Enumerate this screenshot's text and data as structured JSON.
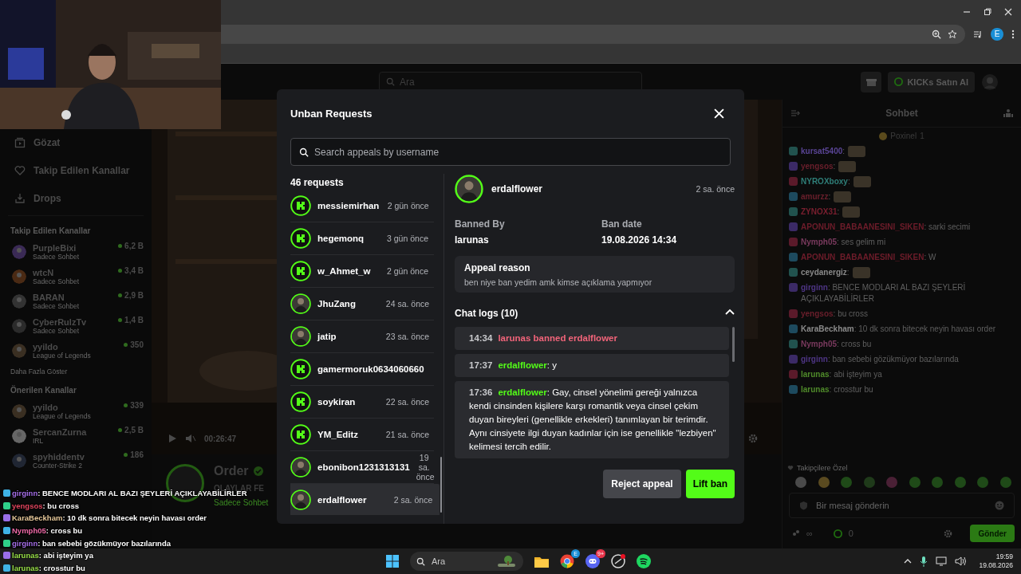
{
  "browser": {
    "profile_initial": "E"
  },
  "site": {
    "search": {
      "placeholder": "Ara"
    },
    "kicks_button": "KICKs Satın Al"
  },
  "sidebar": {
    "nav": [
      {
        "kind": "browse",
        "label": "Gözat"
      },
      {
        "kind": "following",
        "label": "Takip Edilen Kanallar"
      },
      {
        "kind": "drops",
        "label": "Drops"
      }
    ],
    "followed_title": "Takip Edilen Kanallar",
    "followed": [
      {
        "name": "PurpleBixi",
        "category": "Sadece Sohbet",
        "viewers": "6,2 B"
      },
      {
        "name": "wtcN",
        "category": "Sadece Sohbet",
        "viewers": "3,4 B"
      },
      {
        "name": "BARAN",
        "category": "Sadece Sohbet",
        "viewers": "2,9 B"
      },
      {
        "name": "CyberRulzTv",
        "category": "Sadece Sohbet",
        "viewers": "1,4 B"
      },
      {
        "name": "yyildo",
        "category": "League of Legends",
        "viewers": "350"
      }
    ],
    "show_more": "Daha Fazla Göster",
    "recommended_title": "Önerilen Kanallar",
    "recommended": [
      {
        "name": "yyildo",
        "category": "League of Legends",
        "viewers": "339"
      },
      {
        "name": "SercanZurna",
        "category": "IRL",
        "viewers": "2,5 B"
      },
      {
        "name": "spyhiddentv",
        "category": "Counter-Strike 2",
        "viewers": "186"
      }
    ]
  },
  "player": {
    "time": "00:26:47",
    "channel": {
      "name": "Order",
      "verified": true,
      "title": "OLAYLAR FE",
      "category": "Sadece Sohbet"
    }
  },
  "chat": {
    "title": "Sohbet",
    "pinned": {
      "user": "Poxinel",
      "count": "1"
    },
    "messages": [
      {
        "kind": "emote",
        "user": "kursat5400",
        "color": "#5a4596",
        "text": ":"
      },
      {
        "kind": "emote",
        "user": "yengsos",
        "color": "#6b1f2c",
        "text": ":"
      },
      {
        "kind": "emote",
        "user": "NYROXboxy",
        "color": "#2f7f79",
        "text": ":"
      },
      {
        "kind": "emote",
        "user": "amurzz",
        "color": "#6b1f2c",
        "text": ":"
      },
      {
        "kind": "emote",
        "user": "ZYNOX31",
        "color": "#7a1f2f",
        "text": ":"
      },
      {
        "kind": "text",
        "user": "APONUN_BABAANESINI_SIKEN",
        "color": "#6e1c2a",
        "text": ": sarki secimi"
      },
      {
        "kind": "text",
        "user": "Nymph05",
        "color": "#7a3a5e",
        "text": ": ses gelim mi"
      },
      {
        "kind": "text",
        "user": "APONUN_BABAANESINI_SIKEN",
        "color": "#6e1c2a",
        "text": ": W"
      },
      {
        "kind": "emote",
        "user": "ceydanergiz",
        "color": "#8a8a8a",
        "text": ":"
      },
      {
        "kind": "text",
        "user": "girginn",
        "color": "#4e3585",
        "text": ": BENCE MODLARI AL BAZI ŞEYLERİ AÇIKLAYABİLİRLER"
      },
      {
        "kind": "text",
        "user": "yengsos",
        "color": "#6b1f2c",
        "text": ": bu cross"
      },
      {
        "kind": "text",
        "user": "KaraBeckham",
        "color": "#8a8a8a",
        "text": ": 10 dk sonra bitecek neyin havası order"
      },
      {
        "kind": "text",
        "user": "Nymph05",
        "color": "#7a3a5e",
        "text": ": cross bu"
      },
      {
        "kind": "text",
        "user": "girginn",
        "color": "#4e3585",
        "text": ": ban sebebi gözükmüyor bazılarında"
      },
      {
        "kind": "text",
        "user": "larunas",
        "color": "#4f8a2a",
        "text": ": abi işteyim ya"
      },
      {
        "kind": "text",
        "user": "larunas",
        "color": "#4f8a2a",
        "text": ": crosstur bu"
      }
    ],
    "followers_only": "Takipçilere Özel",
    "input": {
      "placeholder": "Bir mesaj gönderin"
    },
    "footer": {
      "infinity": "∞",
      "kicks": "0",
      "send": "Gönder"
    }
  },
  "overlay_chat": [
    {
      "user": "girginn",
      "color": "#a56ee8",
      "text": " : BENCE MODLARI AL BAZI ŞEYLERİ AÇIKLAYABİLİRLER"
    },
    {
      "user": "yengsos",
      "color": "#e0455e",
      "text": " : bu cross"
    },
    {
      "user": "KaraBeckham",
      "color": "#e6c89a",
      "text": " : 10 dk sonra bitecek neyin havası order"
    },
    {
      "user": "Nymph05",
      "color": "#f06aa8",
      "text": " : cross bu"
    },
    {
      "user": "girginn",
      "color": "#a56ee8",
      "text": " : ban sebebi gözükmüyor bazılarında"
    },
    {
      "user": "larunas",
      "color": "#9be24a",
      "text": " : abi işteyim ya"
    },
    {
      "user": "larunas",
      "color": "#9be24a",
      "text": " : crosstur bu"
    }
  ],
  "modal": {
    "title": "Unban Requests",
    "search": {
      "placeholder": "Search appeals by username"
    },
    "count": "46 requests",
    "requests": [
      {
        "name": "messiemirhan",
        "time": "2 gün önce",
        "kind": "default",
        "selected": false
      },
      {
        "name": "hegemonq",
        "time": "3 gün önce",
        "kind": "default",
        "selected": false
      },
      {
        "name": "w_Ahmet_w",
        "time": "2 gün önce",
        "kind": "default",
        "selected": false
      },
      {
        "name": "JhuZang",
        "time": "24 sa. önce",
        "selected": false
      },
      {
        "name": "jatip",
        "time": "23 sa. önce",
        "selected": false
      },
      {
        "name": "gamermoruk0634060660",
        "kind": "default",
        "selected": false
      },
      {
        "name": "soykiran",
        "time": "22 sa. önce",
        "kind": "default",
        "selected": false
      },
      {
        "name": "YM_Editz",
        "time": "21 sa. önce",
        "kind": "default",
        "selected": false
      },
      {
        "name": "ebonibon1231313131",
        "time": "19 sa. önce",
        "selected": false
      },
      {
        "name": "erdalflower",
        "time": "2 sa. önce",
        "selected": true
      }
    ],
    "detail": {
      "name": "erdalflower",
      "time": "2 sa. önce",
      "banned_by_label": "Banned By",
      "banned_by": "larunas",
      "ban_date_label": "Ban date",
      "ban_date": "19.08.2026 14:34",
      "appeal_title": "Appeal reason",
      "appeal_text": "ben niye ban yedim amk kimse açıklama yapmıyor",
      "chat_logs": {
        "title": "Chat logs (10)",
        "expanded": true,
        "entries": [
          {
            "kind": "ban",
            "time": "14:34",
            "text": "larunas banned erdalflower"
          },
          {
            "kind": "message",
            "time": "17:37",
            "user": "erdalflower",
            "text": ": y"
          },
          {
            "kind": "message",
            "time": "17:36",
            "user": "erdalflower",
            "text": ": Gay, cinsel yönelimi gereği yalnızca kendi cinsinden kişilere karşı romantik veya cinsel çekim duyan bireyleri (genellikle erkekleri) tanımlayan bir terimdir. Aynı cinsiyete ilgi duyan kadınlar için ise genellikle \"lezbiyen\" kelimesi tercih edilir."
          }
        ]
      },
      "reject": "Reject appeal",
      "lift": "Lift ban"
    }
  },
  "taskbar": {
    "search": "Ara",
    "chrome_badge": "E",
    "discord_badge": "9+",
    "time": "19:59",
    "date": "19.08.2026"
  }
}
